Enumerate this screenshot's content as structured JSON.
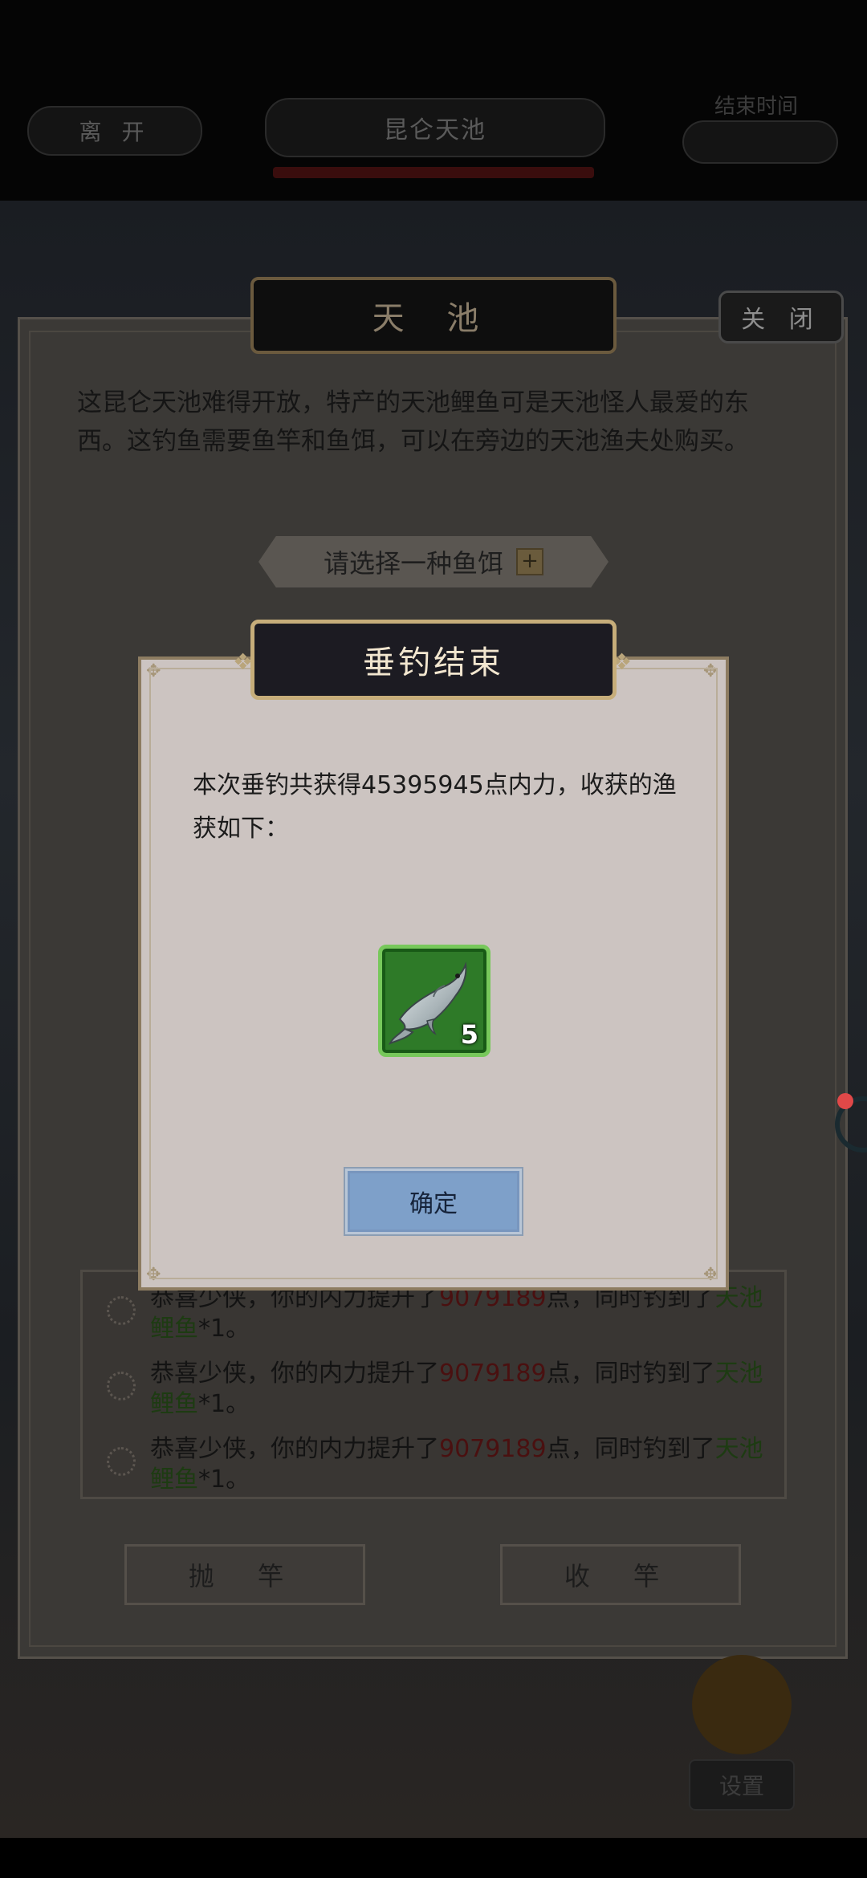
{
  "top_bar": {
    "leave_label": "离 开",
    "location_label": "昆仑天池",
    "end_time_label": "结束时间"
  },
  "panel": {
    "title": "天 池",
    "close_label": "关 闭",
    "description": "这昆仑天池难得开放，特产的天池鲤鱼可是天池怪人最爱的东西。这钓鱼需要鱼竿和鱼饵，可以在旁边的天池渔夫处购买。",
    "bait_prompt": "请选择一种鱼饵",
    "bait_plus": "+",
    "cast_label": "抛 竿",
    "reel_label": "收 竿"
  },
  "log": {
    "entries": [
      {
        "prefix": "恭喜少侠，你的内力提升了",
        "number": "9079189",
        "middle": "点，同时钓到了",
        "fish": "天池鲤鱼",
        "suffix": "*1。"
      },
      {
        "prefix": "恭喜少侠，你的内力提升了",
        "number": "9079189",
        "middle": "点，同时钓到了",
        "fish": "天池鲤鱼",
        "suffix": "*1。"
      },
      {
        "prefix": "恭喜少侠，你的内力提升了",
        "number": "9079189",
        "middle": "点，同时钓到了",
        "fish": "天池鲤鱼",
        "suffix": "*1。"
      }
    ]
  },
  "dialog": {
    "title": "垂钓结束",
    "message": "本次垂钓共获得45395945点内力，收获的渔获如下：",
    "item": {
      "icon": "carp-fish-icon",
      "count": "5"
    },
    "confirm_label": "确定"
  },
  "side": {
    "settings_label": "设置"
  },
  "colors": {
    "dialog_bg": "#ccc4c1",
    "item_frame": "#77c85b",
    "confirm_bg": "#7ea0c9",
    "title_border": "#c6ad7a"
  }
}
